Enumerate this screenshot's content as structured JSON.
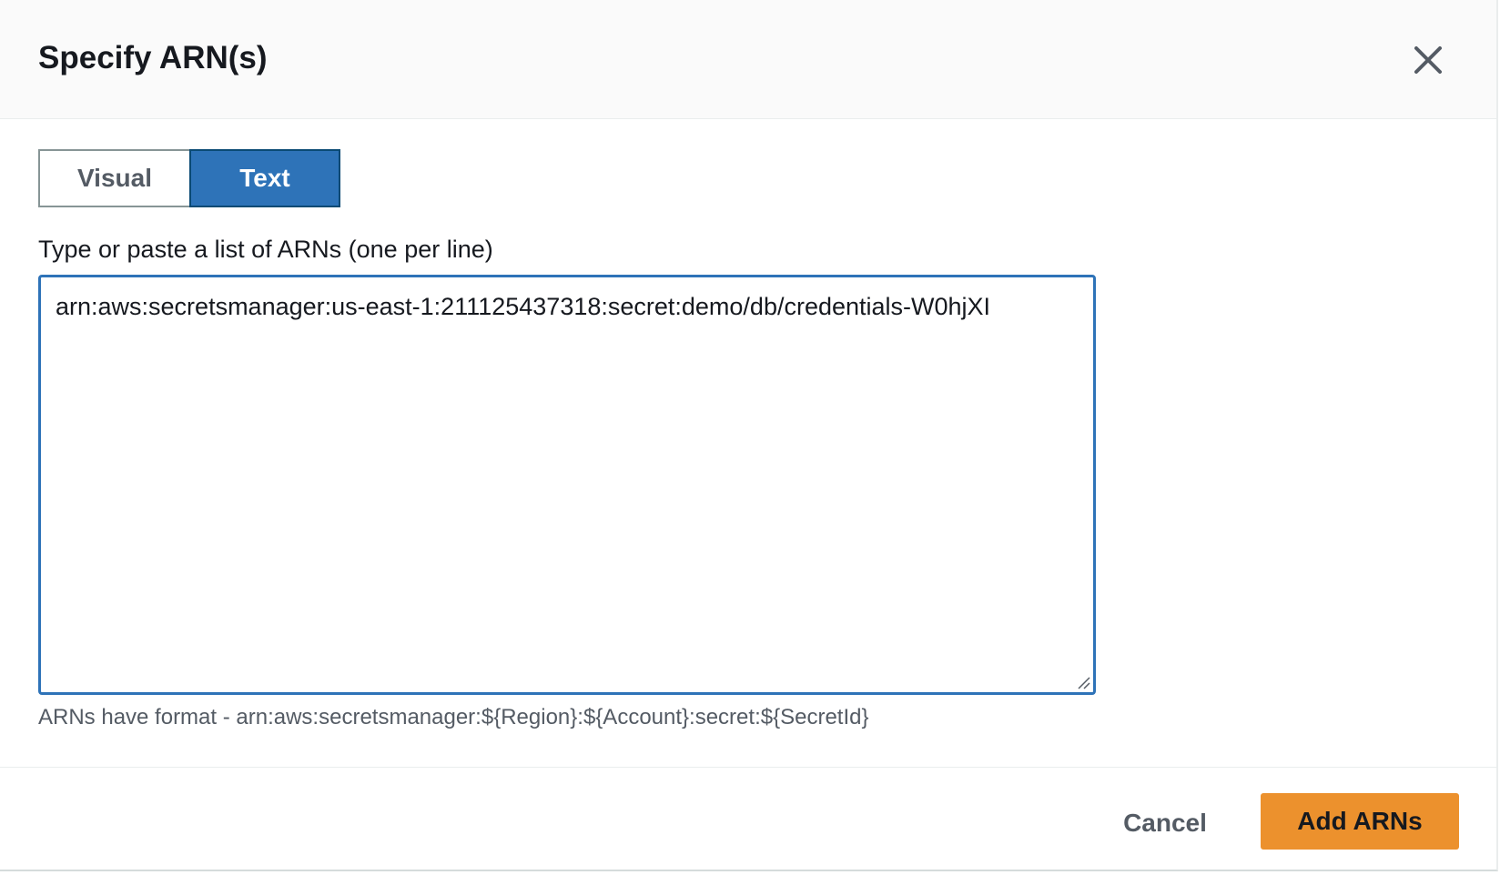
{
  "modal": {
    "title": "Specify ARN(s)",
    "close_icon": "close-icon"
  },
  "toggle": {
    "options": [
      {
        "label": "Visual",
        "selected": false
      },
      {
        "label": "Text",
        "selected": true
      }
    ]
  },
  "arn_input": {
    "label": "Type or paste a list of ARNs (one per line)",
    "value": "arn:aws:secretsmanager:us-east-1:211125437318:secret:demo/db/credentials-W0hjXI",
    "hint": "ARNs have format - arn:aws:secretsmanager:${Region}:${Account}:secret:${SecretId}",
    "resize_icon": "resize-handle-icon"
  },
  "footer": {
    "cancel_label": "Cancel",
    "submit_label": "Add ARNs"
  },
  "colors": {
    "primary_button": "#ec912d",
    "selected_toggle": "#2e73b8",
    "focus_border": "#2e73b8",
    "header_background": "#fafafa"
  }
}
